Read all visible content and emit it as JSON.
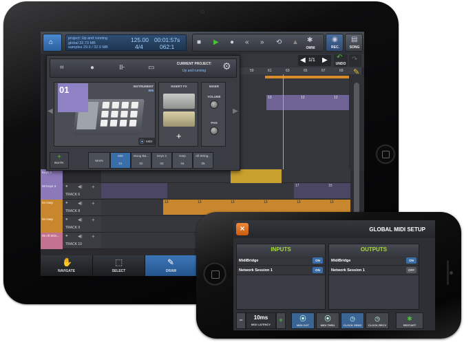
{
  "project": {
    "line1": "project: Up and running",
    "line2": "global 32.73 MB",
    "line3": "samples 29.9 / 32.0 MB",
    "tempo": "125.00",
    "signature": "4/4",
    "time": "00:01:57s",
    "position": "062:1"
  },
  "topbar": {
    "omni": "OMNI",
    "rec": "REC.",
    "song": "SONG"
  },
  "navbar": {
    "page": "1/1",
    "undo": "UNDO"
  },
  "ruler_marks": [
    "59",
    "61",
    "63",
    "65",
    "67",
    "69"
  ],
  "popup": {
    "current_label": "CURRENT PROJECT:",
    "current_value": "Up and running",
    "slot_number": "01",
    "instrument_label": "INSTRUMENT",
    "instrument_sub": "806",
    "insert_fx": "INSERT FX",
    "mixer": "MIXER",
    "volume": "VOLUME",
    "pan": "PAN",
    "midi": "MIDI",
    "add_instr": "INSTR.",
    "plus": "+",
    "main": "MAIN",
    "tabs": [
      {
        "name": "806",
        "num": "01"
      },
      {
        "name": "Moog Ba...",
        "num": "02"
      },
      {
        "name": "Keys 3",
        "num": "03"
      },
      {
        "name": "Harp",
        "num": "04"
      },
      {
        "name": "All String...",
        "num": "05"
      }
    ]
  },
  "tracks": [
    {
      "head": "Keys 3",
      "num": "",
      "label": "",
      "color": "#8c79b9"
    },
    {
      "head": "03 Keys 3",
      "num": "03",
      "label": "TRACK 6",
      "color": "#8c79b9"
    },
    {
      "head": "04 Harp",
      "num": "04",
      "label": "TRACK 8",
      "color": "#c8862d"
    },
    {
      "head": "04 Harp",
      "num": "04",
      "label": "TRACK 9",
      "color": "#c8862d"
    },
    {
      "head": "05 All Strin...",
      "num": "05",
      "label": "TRACK 10",
      "color": "#c2728e"
    }
  ],
  "clip_numbers": [
    "13",
    "12",
    "12",
    "12",
    "17",
    "15",
    "13",
    "13",
    "13",
    "13",
    "13",
    "13",
    "13"
  ],
  "bottombar": {
    "navigate": "NAVIGATE",
    "select": "SELECT",
    "draw": "DRAW"
  },
  "phone": {
    "title": "GLOBAL MIDI SETUP",
    "close": "×",
    "inputs_title": "INPUTS",
    "outputs_title": "OUTPUTS",
    "inputs": [
      {
        "name": "MidiBridge",
        "state": "ON"
      },
      {
        "name": "Network Session 1",
        "state": "ON"
      }
    ],
    "outputs": [
      {
        "name": "MidiBridge",
        "state": "ON"
      },
      {
        "name": "Network Session 1",
        "state": "OFF"
      }
    ],
    "minus": "−",
    "plus": "+",
    "latency_value": "10ms",
    "latency_label": "MIDI LATENCY",
    "buttons": [
      "MIDI OUT",
      "MIDI THRU",
      "CLOCK SEND",
      "CLOCK RECV",
      "RESTART"
    ]
  },
  "colors": {
    "accent_blue": "#3a6ea8",
    "inputs_green": "#a8d940",
    "play_green": "#4cc23a",
    "orange": "#f08a3a"
  }
}
